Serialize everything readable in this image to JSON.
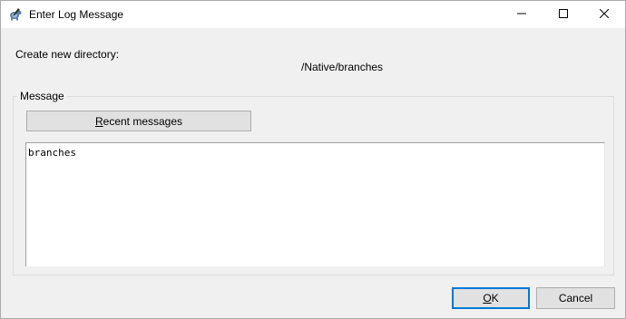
{
  "window": {
    "title": "Enter Log Message",
    "app_icon": "tortoise-svn-icon",
    "controls": {
      "minimize": "minimize-icon",
      "maximize": "maximize-icon",
      "close": "close-icon"
    }
  },
  "action": {
    "label": "Create new directory:",
    "path": "/Native/branches"
  },
  "message_group": {
    "legend": "Message",
    "recent_button": {
      "accel": "R",
      "rest": "ecent messages"
    },
    "text_value": "branches"
  },
  "footer": {
    "ok": {
      "accel": "O",
      "rest": "K"
    },
    "cancel": "Cancel"
  },
  "colors": {
    "background": "#f0f0f0",
    "titlebar": "#ffffff",
    "default_button_border": "#0078d7"
  }
}
